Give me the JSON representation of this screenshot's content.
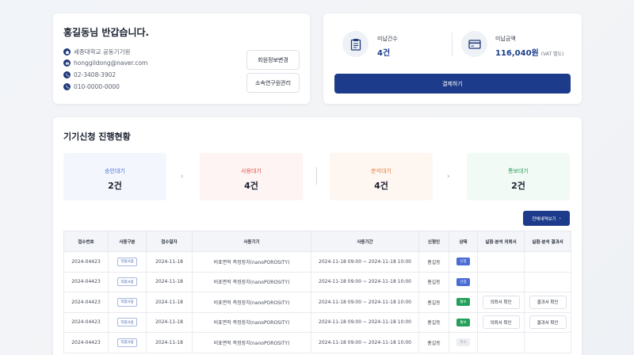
{
  "profile": {
    "greeting": "홍길동님 반갑습니다.",
    "organization": "세종대학교 공동기기원",
    "email": "honggildong@naver.com",
    "phone": "02-3408-3902",
    "mobile": "010-0000-0000",
    "edit_member_button": "회원정보변경",
    "lab_manage_button": "소속연구원관리"
  },
  "payment": {
    "unpaid_count_label": "미납건수",
    "unpaid_count_value": "4건",
    "unpaid_amount_label": "미납금액",
    "unpaid_amount_value": "116,040원",
    "vat_note": "(VAT 별도)",
    "pay_button": "결제하기"
  },
  "status": {
    "title": "기기신청 진행현황",
    "boxes": [
      {
        "label": "승인대기",
        "count": "2건",
        "color": "#4a6cd4",
        "bg": "#f3f7fd"
      },
      {
        "label": "사용대기",
        "count": "4건",
        "color": "#e2564a",
        "bg": "#fdf4f3"
      },
      {
        "label": "분석대기",
        "count": "4건",
        "color": "#e8833a",
        "bg": "#fef6f1"
      },
      {
        "label": "통보대기",
        "count": "2건",
        "color": "#2a9d5c",
        "bg": "#f2faf5"
      }
    ],
    "view_all_button": "전체내역보기",
    "view_all_icon": "chevron-right-icon"
  },
  "table": {
    "headers": [
      "접수번호",
      "사용구분",
      "접수일자",
      "사용기기",
      "사용기간",
      "신청인",
      "상태",
      "실험·분석 의뢰서",
      "실험·분석 결과서"
    ],
    "rows": [
      {
        "no": "2024-04423",
        "type": "직접사용",
        "date": "2024-11-18",
        "device": "비표면적 측정장치(nanoPOROSITY)",
        "period": "2024-11-18 09:00 ~ 2024-11-18 10:00",
        "applicant": "홍길동",
        "status": "신청",
        "request": "",
        "result": ""
      },
      {
        "no": "2024-04423",
        "type": "직접사용",
        "date": "2024-11-18",
        "device": "비표면적 측정장치(nanoPOROSITY)",
        "period": "2024-11-18 09:00 ~ 2024-11-18 10:00",
        "applicant": "홍길동",
        "status": "신청",
        "request": "",
        "result": ""
      },
      {
        "no": "2024-04423",
        "type": "직접사용",
        "date": "2024-11-18",
        "device": "비표면적 측정장치(nanoPOROSITY)",
        "period": "2024-11-18 09:00 ~ 2024-11-18 10:00",
        "applicant": "홍길동",
        "status": "통보",
        "request": "의뢰서 확인",
        "result": "결과서 확인"
      },
      {
        "no": "2024-04423",
        "type": "직접사용",
        "date": "2024-11-18",
        "device": "비표면적 측정장치(nanoPOROSITY)",
        "period": "2024-11-18 09:00 ~ 2024-11-18 10:00",
        "applicant": "홍길동",
        "status": "통보",
        "request": "의뢰서 확인",
        "result": "결과서 확인"
      },
      {
        "no": "2024-04423",
        "type": "직접사용",
        "date": "2024-11-18",
        "device": "비표면적 측정장치(nanoPOROSITY)",
        "period": "2024-11-18 09:00 ~ 2024-11-18 10:00",
        "applicant": "홍길동",
        "status": "취소",
        "request": "",
        "result": ""
      }
    ]
  }
}
